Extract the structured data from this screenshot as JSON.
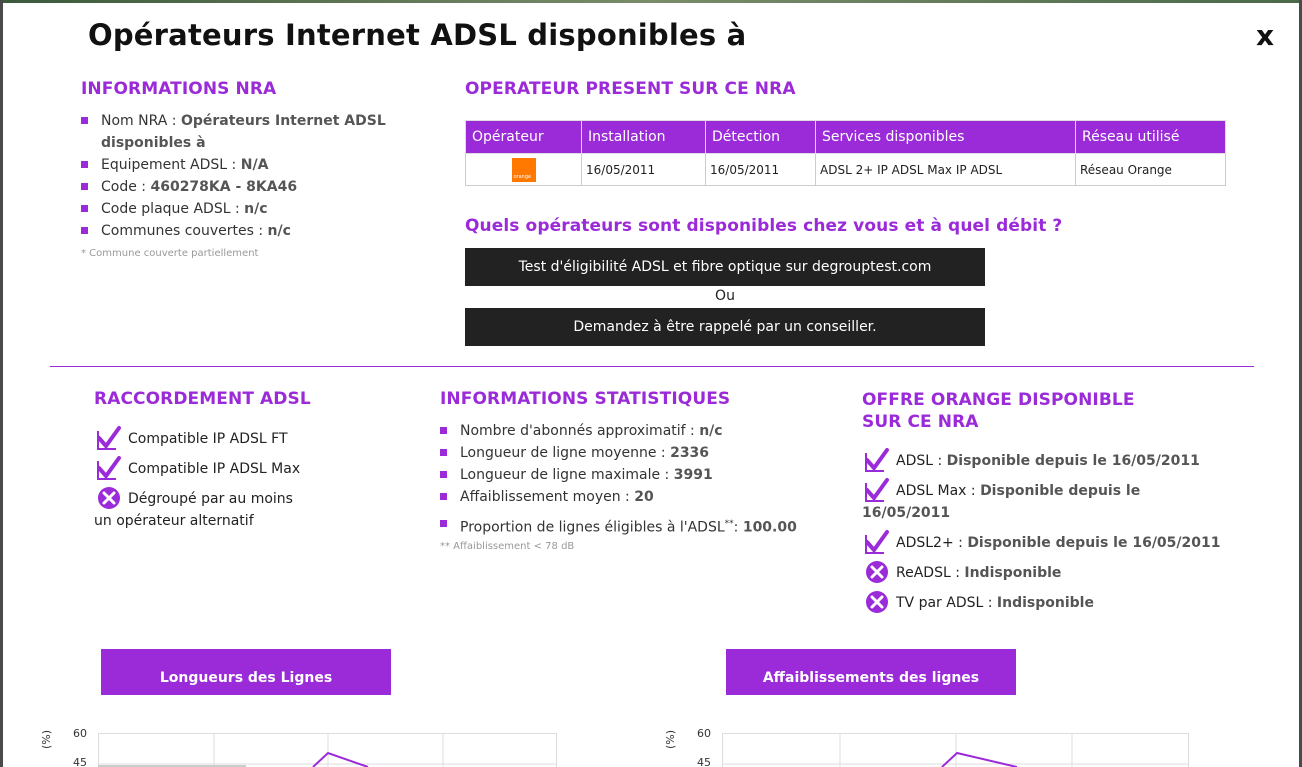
{
  "title": "Opérateurs Internet ADSL disponibles à",
  "close_label": "x",
  "nra": {
    "heading": "INFORMATIONS NRA",
    "nom_label": "Nom NRA : ",
    "nom_value": "Opérateurs Internet ADSL disponibles à",
    "equip_label": "Equipement ADSL : ",
    "equip_value": "N/A",
    "code_label": "Code : ",
    "code_value": "460278KA - 8KA46",
    "plaque_label": "Code plaque ADSL : ",
    "plaque_value": "n/c",
    "communes_label": "Communes couvertes : ",
    "communes_value": "n/c",
    "footnote": "* Commune couverte partiellement"
  },
  "operator": {
    "heading": "OPERATEUR PRESENT SUR CE NRA",
    "columns": [
      "Opérateur",
      "Installation",
      "Détection",
      "Services disponibles",
      "Réseau utilisé"
    ],
    "row": {
      "logo_text": "orange",
      "installation": "16/05/2011",
      "detection": "16/05/2011",
      "services": "ADSL 2+ IP ADSL Max IP ADSL",
      "reseau": "Réseau Orange"
    }
  },
  "question": {
    "heading": "Quels opérateurs sont disponibles chez vous et à quel débit ?",
    "test_button": "Test d'éligibilité ADSL et fibre optique sur degrouptest.com",
    "or_label": "Ou",
    "callback_button": "Demandez à être rappelé par un conseiller."
  },
  "raccordement": {
    "heading": "RACCORDEMENT ADSL",
    "items": [
      {
        "text": "Compatible IP ADSL FT",
        "status": "check"
      },
      {
        "text": "Compatible IP ADSL Max",
        "status": "check"
      },
      {
        "text": "Dégroupé par au moins",
        "text2": "un opérateur alternatif",
        "status": "cross"
      }
    ]
  },
  "stats": {
    "heading": "INFORMATIONS STATISTIQUES",
    "abonnes_label": "Nombre d'abonnés approximatif : ",
    "abonnes_value": "n/c",
    "moyenne_label": "Longueur de ligne moyenne : ",
    "moyenne_value": "2336",
    "maximale_label": "Longueur de ligne maximale : ",
    "maximale_value": "3991",
    "affaib_label": "Affaiblissement moyen : ",
    "affaib_value": "20",
    "proportion_label": "Proportion de lignes éligibles à l'ADSL",
    "proportion_sup": "**",
    "proportion_value": "100.00",
    "footnote": "** Affaiblissement < 78 dB"
  },
  "offre": {
    "heading_line1": "OFFRE ORANGE DISPONIBLE",
    "heading_line2": "SUR CE NRA",
    "items": [
      {
        "label": "ADSL : ",
        "value": "Disponible depuis le 16/05/2011",
        "status": "check"
      },
      {
        "label": "ADSL Max : ",
        "value": "Disponible depuis le",
        "value2": "16/05/2011",
        "status": "check"
      },
      {
        "label": "ADSL2+ : ",
        "value": "Disponible depuis le 16/05/2011",
        "status": "check"
      },
      {
        "label": "ReADSL : ",
        "value": "Indisponible",
        "status": "cross"
      },
      {
        "label": "TV par ADSL : ",
        "value": "Indisponible",
        "status": "cross"
      }
    ]
  },
  "charts": {
    "longueurs_tab": "Longueurs des Lignes",
    "affaib_tab": "Affaiblissements des lignes",
    "y_unit": "(%)",
    "y_tick_top": "60",
    "y_tick_second": "45"
  },
  "colors": {
    "accent": "#9b2bd8",
    "dark_button": "#222222",
    "orange_brand": "#ff7900"
  }
}
